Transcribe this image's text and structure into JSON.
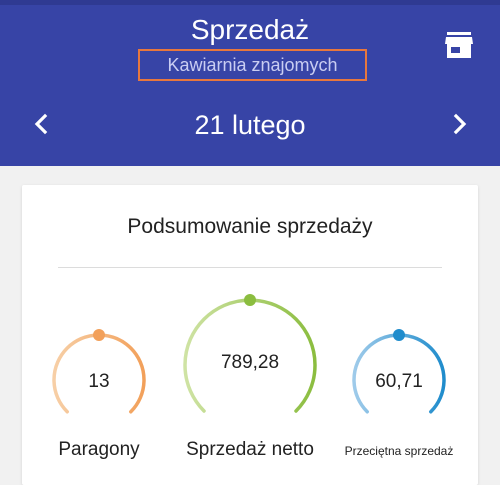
{
  "header": {
    "title": "Sprzedaż",
    "subtitle": "Kawiarnia znajomych",
    "date": "21 lutego",
    "icons": {
      "store": "store-icon",
      "prev": "chevron-left-icon",
      "next": "chevron-right-icon"
    },
    "colors": {
      "background": "#3744a6",
      "highlight_border": "#e8773d"
    }
  },
  "summary": {
    "title": "Podsumowanie sprzedaży",
    "gauges": [
      {
        "value": "13",
        "label": "Paragony",
        "color": "#f2a05a",
        "light_color": "#f7cfa6"
      },
      {
        "value": "789,28",
        "label": "Sprzedaż netto",
        "color": "#8bbd3f",
        "light_color": "#cfe3a4"
      },
      {
        "value": "60,71",
        "label": "Przeciętna sprzedaż",
        "color": "#1f8ccc",
        "light_color": "#9fcbea"
      }
    ]
  }
}
